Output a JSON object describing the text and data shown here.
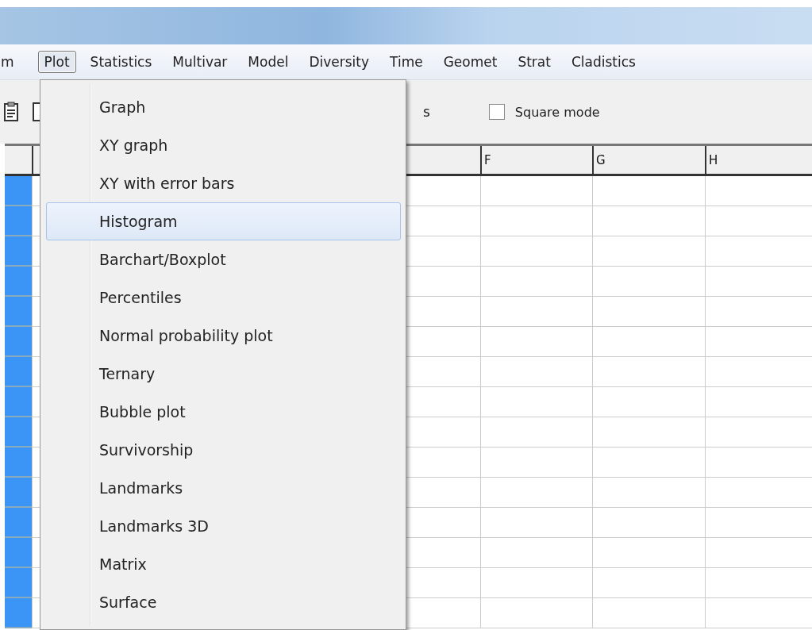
{
  "menu_bar": [
    {
      "label": "m",
      "selected": false
    },
    {
      "label": "Plot",
      "selected": true
    },
    {
      "label": "Statistics",
      "selected": false
    },
    {
      "label": "Multivar",
      "selected": false
    },
    {
      "label": "Model",
      "selected": false
    },
    {
      "label": "Diversity",
      "selected": false
    },
    {
      "label": "Time",
      "selected": false
    },
    {
      "label": "Geomet",
      "selected": false
    },
    {
      "label": "Strat",
      "selected": false
    },
    {
      "label": "Cladistics",
      "selected": false
    }
  ],
  "toolbar": {
    "label_fragment": "s",
    "checkbox": {
      "label": "Square mode",
      "checked": false
    }
  },
  "grid": {
    "columns": [
      "F",
      "G",
      "H"
    ]
  },
  "plot_menu": {
    "items": [
      {
        "label": "Graph",
        "selected": false
      },
      {
        "label": "XY graph",
        "selected": false
      },
      {
        "label": "XY with error bars",
        "selected": false
      },
      {
        "label": "Histogram",
        "selected": true
      },
      {
        "label": "Barchart/Boxplot",
        "selected": false
      },
      {
        "label": "Percentiles",
        "selected": false
      },
      {
        "label": "Normal probability plot",
        "selected": false
      },
      {
        "label": "Ternary",
        "selected": false
      },
      {
        "label": "Bubble plot",
        "selected": false
      },
      {
        "label": "Survivorship",
        "selected": false
      },
      {
        "label": "Landmarks",
        "selected": false
      },
      {
        "label": "Landmarks 3D",
        "selected": false
      },
      {
        "label": "Matrix",
        "selected": false
      },
      {
        "label": "Surface",
        "selected": false
      }
    ]
  }
}
